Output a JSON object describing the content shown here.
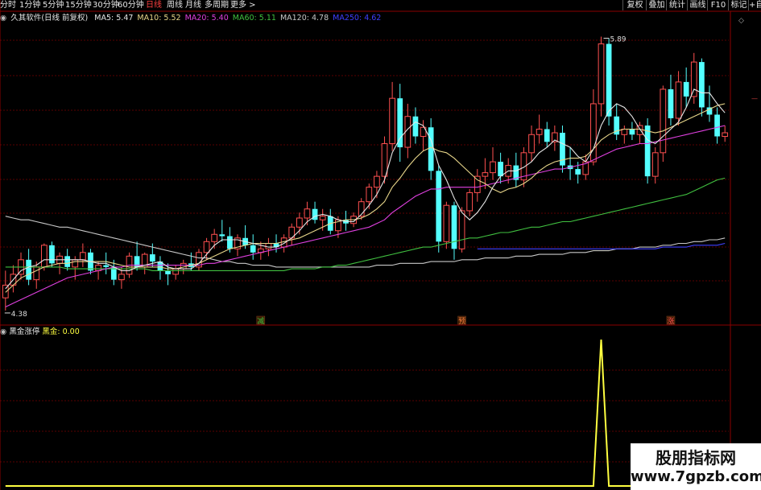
{
  "toolbar": {
    "periods": [
      "分时",
      "1分钟",
      "5分钟",
      "15分钟",
      "30分钟",
      "60分钟",
      "日线",
      "周线",
      "月线",
      "多周期",
      "更多 >"
    ],
    "active": "日线",
    "right_buttons": [
      "复权",
      "叠加",
      "统计",
      "画线",
      "F10",
      "标记",
      "+自"
    ]
  },
  "legend": {
    "title": "久其软件(日线 前复权)",
    "ma": [
      {
        "label": "MA5: 5.47",
        "color": "#e6e6e6"
      },
      {
        "label": "MA10: 5.52",
        "color": "#e8d68a"
      },
      {
        "label": "MA20: 5.40",
        "color": "#e040e0"
      },
      {
        "label": "MA60: 5.11",
        "color": "#40c040"
      },
      {
        "label": "MA120: 4.78",
        "color": "#c8c8c8"
      },
      {
        "label": "MA250: 4.62",
        "color": "#4040ff"
      }
    ]
  },
  "indicator": {
    "title": "黑金涨停",
    "value_label": "黑金: 0.00"
  },
  "annotations": {
    "high": "5.89",
    "low": "4.38",
    "markers": [
      "减",
      "预",
      "涨"
    ]
  },
  "watermark": {
    "text": "股朋指标网",
    "url": "www.7gpzb.com"
  },
  "colors": {
    "up": "#ff5050",
    "down": "#54ffff",
    "grid": "#5a0000",
    "ma5": "#e6e6e6",
    "ma10": "#e8d68a",
    "ma20": "#e040e0",
    "ma60": "#40c040",
    "ma120": "#c8c8c8",
    "ma250": "#4040ff",
    "indicator": "#ffff40"
  },
  "chart_data": [
    {
      "type": "candlestick",
      "title": "久其软件(日线 前复权)",
      "ylim": [
        4.3,
        5.95
      ],
      "grid": true,
      "candles": [
        [
          4.45,
          4.6,
          4.38,
          4.52
        ],
        [
          4.52,
          4.63,
          4.48,
          4.58
        ],
        [
          4.58,
          4.7,
          4.55,
          4.66
        ],
        [
          4.66,
          4.72,
          4.52,
          4.55
        ],
        [
          4.55,
          4.65,
          4.5,
          4.62
        ],
        [
          4.62,
          4.75,
          4.6,
          4.74
        ],
        [
          4.74,
          4.76,
          4.62,
          4.64
        ],
        [
          4.64,
          4.7,
          4.58,
          4.68
        ],
        [
          4.68,
          4.72,
          4.6,
          4.62
        ],
        [
          4.62,
          4.68,
          4.55,
          4.66
        ],
        [
          4.66,
          4.75,
          4.62,
          4.7
        ],
        [
          4.7,
          4.72,
          4.58,
          4.6
        ],
        [
          4.6,
          4.65,
          4.55,
          4.63
        ],
        [
          4.63,
          4.7,
          4.58,
          4.62
        ],
        [
          4.62,
          4.66,
          4.52,
          4.55
        ],
        [
          4.55,
          4.62,
          4.5,
          4.58
        ],
        [
          4.58,
          4.7,
          4.56,
          4.68
        ],
        [
          4.68,
          4.76,
          4.6,
          4.62
        ],
        [
          4.62,
          4.7,
          4.58,
          4.69
        ],
        [
          4.69,
          4.75,
          4.62,
          4.65
        ],
        [
          4.65,
          4.68,
          4.55,
          4.6
        ],
        [
          4.6,
          4.64,
          4.52,
          4.58
        ],
        [
          4.58,
          4.63,
          4.55,
          4.61
        ],
        [
          4.61,
          4.66,
          4.58,
          4.64
        ],
        [
          4.64,
          4.7,
          4.6,
          4.62
        ],
        [
          4.62,
          4.72,
          4.6,
          4.7
        ],
        [
          4.7,
          4.78,
          4.66,
          4.76
        ],
        [
          4.76,
          4.83,
          4.72,
          4.8
        ],
        [
          4.8,
          4.88,
          4.76,
          4.79
        ],
        [
          4.79,
          4.84,
          4.7,
          4.72
        ],
        [
          4.72,
          4.8,
          4.68,
          4.78
        ],
        [
          4.78,
          4.85,
          4.72,
          4.74
        ],
        [
          4.74,
          4.8,
          4.66,
          4.7
        ],
        [
          4.7,
          4.76,
          4.66,
          4.72
        ],
        [
          4.72,
          4.78,
          4.68,
          4.75
        ],
        [
          4.75,
          4.8,
          4.7,
          4.73
        ],
        [
          4.73,
          4.8,
          4.7,
          4.78
        ],
        [
          4.78,
          4.86,
          4.74,
          4.84
        ],
        [
          4.84,
          4.92,
          4.8,
          4.89
        ],
        [
          4.89,
          4.98,
          4.85,
          4.94
        ],
        [
          4.94,
          4.98,
          4.86,
          4.88
        ],
        [
          4.88,
          4.94,
          4.82,
          4.9
        ],
        [
          4.9,
          4.94,
          4.8,
          4.82
        ],
        [
          4.82,
          4.9,
          4.78,
          4.88
        ],
        [
          4.88,
          4.93,
          4.82,
          4.86
        ],
        [
          4.86,
          4.92,
          4.84,
          4.9
        ],
        [
          4.9,
          5.0,
          4.88,
          4.98
        ],
        [
          4.98,
          5.08,
          4.94,
          5.06
        ],
        [
          5.06,
          5.15,
          5.0,
          5.12
        ],
        [
          5.12,
          5.34,
          5.08,
          5.3
        ],
        [
          5.3,
          5.64,
          5.26,
          5.55
        ],
        [
          5.55,
          5.63,
          5.2,
          5.28
        ],
        [
          5.28,
          5.52,
          5.22,
          5.45
        ],
        [
          5.45,
          5.5,
          5.3,
          5.34
        ],
        [
          5.34,
          5.43,
          5.26,
          5.39
        ],
        [
          5.39,
          5.44,
          5.1,
          5.15
        ],
        [
          5.15,
          5.18,
          4.7,
          4.76
        ],
        [
          4.76,
          4.98,
          4.72,
          4.96
        ],
        [
          4.96,
          4.98,
          4.66,
          4.72
        ],
        [
          4.72,
          4.95,
          4.7,
          4.93
        ],
        [
          4.93,
          5.05,
          4.9,
          5.03
        ],
        [
          5.03,
          5.16,
          4.98,
          5.12
        ],
        [
          5.12,
          5.22,
          5.05,
          5.14
        ],
        [
          5.14,
          5.28,
          5.1,
          5.2
        ],
        [
          5.2,
          5.25,
          5.08,
          5.12
        ],
        [
          5.12,
          5.22,
          5.08,
          5.18
        ],
        [
          5.18,
          5.25,
          5.06,
          5.1
        ],
        [
          5.1,
          5.28,
          5.06,
          5.25
        ],
        [
          5.25,
          5.4,
          5.2,
          5.35
        ],
        [
          5.35,
          5.46,
          5.3,
          5.38
        ],
        [
          5.38,
          5.42,
          5.28,
          5.31
        ],
        [
          5.31,
          5.4,
          5.26,
          5.36
        ],
        [
          5.36,
          5.4,
          5.14,
          5.18
        ],
        [
          5.18,
          5.28,
          5.1,
          5.16
        ],
        [
          5.16,
          5.2,
          5.08,
          5.13
        ],
        [
          5.13,
          5.24,
          5.1,
          5.2
        ],
        [
          5.2,
          5.6,
          5.18,
          5.52
        ],
        [
          5.52,
          5.89,
          5.45,
          5.85
        ],
        [
          5.85,
          5.88,
          5.4,
          5.45
        ],
        [
          5.45,
          5.52,
          5.32,
          5.35
        ],
        [
          5.35,
          5.4,
          5.3,
          5.38
        ],
        [
          5.38,
          5.42,
          5.32,
          5.35
        ],
        [
          5.35,
          5.42,
          5.3,
          5.4
        ],
        [
          5.4,
          5.44,
          5.08,
          5.12
        ],
        [
          5.12,
          5.28,
          5.08,
          5.25
        ],
        [
          5.25,
          5.62,
          5.2,
          5.6
        ],
        [
          5.6,
          5.68,
          5.4,
          5.44
        ],
        [
          5.44,
          5.7,
          5.4,
          5.64
        ],
        [
          5.64,
          5.72,
          5.5,
          5.56
        ],
        [
          5.56,
          5.8,
          5.52,
          5.75
        ],
        [
          5.75,
          5.77,
          5.45,
          5.5
        ],
        [
          5.5,
          5.62,
          5.42,
          5.46
        ],
        [
          5.46,
          5.5,
          5.3,
          5.34
        ],
        [
          5.34,
          5.4,
          5.31,
          5.36
        ]
      ],
      "ma5": [
        4.5,
        4.55,
        4.6,
        4.62,
        4.63,
        4.66,
        4.66,
        4.66,
        4.66,
        4.66,
        4.66,
        4.65,
        4.64,
        4.64,
        4.62,
        4.6,
        4.6,
        4.62,
        4.63,
        4.64,
        4.65,
        4.62,
        4.61,
        4.61,
        4.61,
        4.64,
        4.69,
        4.74,
        4.77,
        4.77,
        4.77,
        4.76,
        4.75,
        4.74,
        4.73,
        4.73,
        4.75,
        4.78,
        4.82,
        4.87,
        4.9,
        4.91,
        4.9,
        4.88,
        4.87,
        4.87,
        4.91,
        4.96,
        5.02,
        5.1,
        5.25,
        5.33,
        5.38,
        5.42,
        5.4,
        5.32,
        5.18,
        5.1,
        5.0,
        4.92,
        4.88,
        4.92,
        4.98,
        5.06,
        5.12,
        5.15,
        5.15,
        5.17,
        5.2,
        5.25,
        5.28,
        5.32,
        5.3,
        5.28,
        5.23,
        5.2,
        5.27,
        5.4,
        5.48,
        5.52,
        5.5,
        5.45,
        5.38,
        5.32,
        5.3,
        5.34,
        5.38,
        5.42,
        5.5,
        5.6,
        5.58,
        5.58,
        5.52,
        5.47
      ],
      "ma10": [
        4.48,
        4.52,
        4.56,
        4.58,
        4.6,
        4.62,
        4.63,
        4.64,
        4.64,
        4.65,
        4.65,
        4.65,
        4.65,
        4.65,
        4.64,
        4.63,
        4.62,
        4.62,
        4.62,
        4.62,
        4.62,
        4.61,
        4.61,
        4.62,
        4.63,
        4.64,
        4.66,
        4.68,
        4.7,
        4.72,
        4.73,
        4.74,
        4.75,
        4.75,
        4.75,
        4.75,
        4.76,
        4.77,
        4.78,
        4.8,
        4.82,
        4.84,
        4.86,
        4.87,
        4.88,
        4.88,
        4.89,
        4.91,
        4.94,
        4.98,
        5.06,
        5.11,
        5.17,
        5.22,
        5.26,
        5.28,
        5.26,
        5.25,
        5.22,
        5.18,
        5.14,
        5.1,
        5.08,
        5.05,
        5.03,
        5.05,
        5.06,
        5.08,
        5.11,
        5.15,
        5.18,
        5.2,
        5.21,
        5.22,
        5.22,
        5.23,
        5.27,
        5.32,
        5.35,
        5.37,
        5.38,
        5.38,
        5.38,
        5.37,
        5.36,
        5.37,
        5.39,
        5.41,
        5.43,
        5.45,
        5.47,
        5.49,
        5.51,
        5.52
      ],
      "ma20": [
        4.4,
        4.42,
        4.44,
        4.46,
        4.48,
        4.5,
        4.52,
        4.54,
        4.56,
        4.57,
        4.58,
        4.59,
        4.6,
        4.61,
        4.62,
        4.62,
        4.63,
        4.63,
        4.63,
        4.63,
        4.63,
        4.63,
        4.63,
        4.63,
        4.63,
        4.63,
        4.64,
        4.64,
        4.65,
        4.66,
        4.67,
        4.68,
        4.69,
        4.7,
        4.71,
        4.72,
        4.73,
        4.74,
        4.75,
        4.76,
        4.77,
        4.78,
        4.79,
        4.8,
        4.81,
        4.82,
        4.83,
        4.84,
        4.86,
        4.88,
        4.92,
        4.95,
        4.98,
        5.01,
        5.03,
        5.05,
        5.05,
        5.06,
        5.06,
        5.06,
        5.06,
        5.06,
        5.07,
        5.08,
        5.09,
        5.1,
        5.11,
        5.12,
        5.13,
        5.14,
        5.15,
        5.16,
        5.16,
        5.17,
        5.18,
        5.19,
        5.21,
        5.23,
        5.25,
        5.27,
        5.28,
        5.29,
        5.3,
        5.3,
        5.31,
        5.32,
        5.33,
        5.34,
        5.35,
        5.36,
        5.37,
        5.38,
        5.39,
        5.4
      ],
      "ma60": [
        4.62,
        4.62,
        4.62,
        4.62,
        4.62,
        4.62,
        4.62,
        4.62,
        4.61,
        4.61,
        4.61,
        4.61,
        4.61,
        4.61,
        4.61,
        4.61,
        4.61,
        4.61,
        4.61,
        4.6,
        4.6,
        4.6,
        4.6,
        4.6,
        4.6,
        4.6,
        4.6,
        4.6,
        4.6,
        4.6,
        4.6,
        4.6,
        4.6,
        4.6,
        4.6,
        4.6,
        4.6,
        4.61,
        4.61,
        4.61,
        4.61,
        4.62,
        4.62,
        4.63,
        4.63,
        4.64,
        4.65,
        4.66,
        4.67,
        4.68,
        4.69,
        4.7,
        4.71,
        4.72,
        4.73,
        4.73,
        4.74,
        4.75,
        4.76,
        4.77,
        4.78,
        4.78,
        4.79,
        4.8,
        4.81,
        4.81,
        4.82,
        4.83,
        4.84,
        4.84,
        4.85,
        4.86,
        4.87,
        4.87,
        4.88,
        4.89,
        4.9,
        4.91,
        4.92,
        4.93,
        4.94,
        4.95,
        4.96,
        4.97,
        4.98,
        4.99,
        5.0,
        5.01,
        5.02,
        5.04,
        5.06,
        5.08,
        5.1,
        5.11
      ],
      "ma120": [
        4.9,
        4.89,
        4.88,
        4.88,
        4.87,
        4.86,
        4.85,
        4.84,
        4.84,
        4.83,
        4.82,
        4.81,
        4.8,
        4.79,
        4.78,
        4.77,
        4.76,
        4.75,
        4.74,
        4.73,
        4.72,
        4.71,
        4.7,
        4.69,
        4.68,
        4.67,
        4.67,
        4.66,
        4.65,
        4.65,
        4.64,
        4.64,
        4.63,
        4.63,
        4.63,
        4.62,
        4.62,
        4.62,
        4.62,
        4.62,
        4.62,
        4.62,
        4.62,
        4.62,
        4.62,
        4.62,
        4.62,
        4.62,
        4.63,
        4.63,
        4.63,
        4.64,
        4.64,
        4.64,
        4.64,
        4.65,
        4.65,
        4.65,
        4.65,
        4.66,
        4.66,
        4.66,
        4.67,
        4.67,
        4.67,
        4.67,
        4.68,
        4.68,
        4.68,
        4.69,
        4.69,
        4.69,
        4.69,
        4.7,
        4.7,
        4.7,
        4.71,
        4.71,
        4.71,
        4.72,
        4.72,
        4.72,
        4.73,
        4.73,
        4.73,
        4.74,
        4.74,
        4.75,
        4.75,
        4.76,
        4.76,
        4.77,
        4.77,
        4.78
      ],
      "ma250": [
        null,
        null,
        null,
        null,
        null,
        null,
        null,
        null,
        null,
        null,
        null,
        null,
        null,
        null,
        null,
        null,
        null,
        null,
        null,
        null,
        null,
        null,
        null,
        null,
        null,
        null,
        null,
        null,
        null,
        null,
        null,
        null,
        null,
        null,
        null,
        null,
        null,
        null,
        null,
        null,
        null,
        null,
        null,
        null,
        null,
        null,
        null,
        null,
        null,
        null,
        null,
        null,
        null,
        null,
        null,
        null,
        null,
        null,
        null,
        null,
        null,
        4.72,
        4.72,
        4.72,
        4.72,
        4.72,
        4.72,
        4.72,
        4.72,
        4.72,
        4.72,
        4.72,
        4.72,
        4.72,
        4.72,
        4.72,
        4.72,
        4.72,
        4.72,
        4.72,
        4.72,
        4.72,
        4.72,
        4.72,
        4.72,
        4.73,
        4.73,
        4.73,
        4.73,
        4.74,
        4.74,
        4.74,
        4.74,
        4.75
      ]
    },
    {
      "type": "line",
      "title": "黑金涨停",
      "ylim": [
        0,
        1
      ],
      "values": [
        0,
        0,
        0,
        0,
        0,
        0,
        0,
        0,
        0,
        0,
        0,
        0,
        0,
        0,
        0,
        0,
        0,
        0,
        0,
        0,
        0,
        0,
        0,
        0,
        0,
        0,
        0,
        0,
        0,
        0,
        0,
        0,
        0,
        0,
        0,
        0,
        0,
        0,
        0,
        0,
        0,
        0,
        0,
        0,
        0,
        0,
        0,
        0,
        0,
        0,
        0,
        0,
        0,
        0,
        0,
        0,
        0,
        0,
        0,
        0,
        0,
        0,
        0,
        0,
        0,
        0,
        0,
        0,
        0,
        0,
        0,
        0,
        0,
        0,
        0,
        0,
        0,
        1,
        0,
        0,
        0,
        0,
        0,
        0,
        0,
        0,
        0,
        0,
        0,
        0,
        0,
        0,
        0,
        0
      ]
    }
  ]
}
